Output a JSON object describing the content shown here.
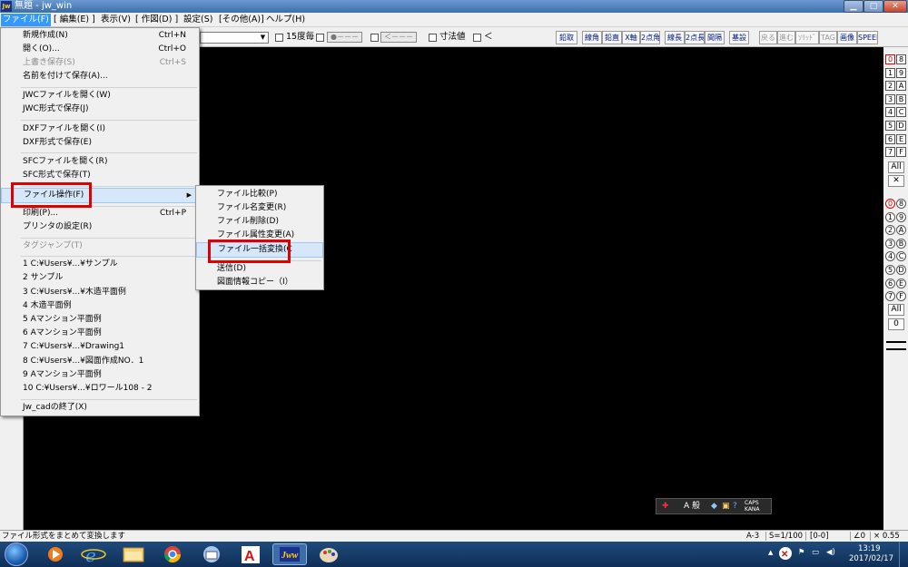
{
  "window": {
    "title": "無題 - jw_win",
    "app_icon": "Jw"
  },
  "menubar": [
    "ファイル(F)",
    "[ 編集(E) ]",
    "表示(V)",
    "[ 作図(D) ]",
    "設定(S)",
    "[その他(A)]",
    "ヘルプ(H)"
  ],
  "toolbar": {
    "check_15": "15度毎",
    "dash_box": "●－－－",
    "arrow_box": "＜－－－",
    "check_dim": "寸法値",
    "check_lt": "＜",
    "buttons": [
      "鉛取",
      "線角",
      "鉛直",
      "X軸",
      "2点角",
      "線長",
      "2点長",
      "間隔",
      "基設"
    ],
    "buttons_right": [
      "戻る",
      "進む",
      "ｿﾘｯﾄﾞ",
      "TAG",
      "画像",
      "SPEED"
    ],
    "disabled_right": [
      "戻る",
      "進む",
      "ｿﾘｯﾄﾞ",
      "TAG"
    ]
  },
  "file_menu": {
    "items": [
      {
        "label": "新規作成(N)",
        "shortcut": "Ctrl+N"
      },
      {
        "label": "開く(O)...",
        "shortcut": "Ctrl+O"
      },
      {
        "label": "上書き保存(S)",
        "shortcut": "Ctrl+S",
        "disabled": true
      },
      {
        "label": "名前を付けて保存(A)...",
        "shortcut": ""
      },
      {
        "label": "JWCファイルを開く(W)",
        "shortcut": ""
      },
      {
        "label": "JWC形式で保存(J)",
        "shortcut": ""
      },
      {
        "label": "DXFファイルを開く(I)",
        "shortcut": ""
      },
      {
        "label": "DXF形式で保存(E)",
        "shortcut": ""
      },
      {
        "label": "SFCファイルを開く(R)",
        "shortcut": ""
      },
      {
        "label": "SFC形式で保存(T)",
        "shortcut": ""
      },
      {
        "label": "ファイル操作(F)",
        "shortcut": "",
        "submenu": true
      },
      {
        "label": "印刷(P)...",
        "shortcut": "Ctrl+P"
      },
      {
        "label": "プリンタの設定(R)",
        "shortcut": ""
      },
      {
        "label": "タグジャンプ(T)",
        "shortcut": "",
        "disabled": true
      },
      {
        "label": "1 C:¥Users¥...¥サンプル",
        "shortcut": ""
      },
      {
        "label": "2 サンプル",
        "shortcut": ""
      },
      {
        "label": "3 C:¥Users¥...¥木造平面例",
        "shortcut": ""
      },
      {
        "label": "4 木造平面例",
        "shortcut": ""
      },
      {
        "label": "5 Aマンション平面例",
        "shortcut": ""
      },
      {
        "label": "6 Aマンション平面例",
        "shortcut": ""
      },
      {
        "label": "7 C:¥Users¥...¥Drawing1",
        "shortcut": ""
      },
      {
        "label": "8 C:¥Users¥...¥図面作成NO．1",
        "shortcut": ""
      },
      {
        "label": "9 Aマンション平面例",
        "shortcut": ""
      },
      {
        "label": "10 C:¥Users¥...¥ロワール108 - 2",
        "shortcut": ""
      },
      {
        "label": "Jw_cadの終了(X)",
        "shortcut": ""
      }
    ]
  },
  "file_ops_submenu": {
    "items": [
      "ファイル比較(P)",
      "ファイル名変更(R)",
      "ファイル削除(D)",
      "ファイル属性変更(A)",
      "ファイル一括変換(C",
      "送信(D)",
      "図面情報コピー（I）"
    ]
  },
  "layers": {
    "group_labels": [
      "0",
      "1",
      "2",
      "3",
      "4",
      "5",
      "6",
      "7"
    ],
    "group_hex": [
      "8",
      "9",
      "A",
      "B",
      "C",
      "D",
      "E",
      "F"
    ],
    "layer_labels": [
      "0",
      "1",
      "2",
      "3",
      "4",
      "5",
      "6",
      "7"
    ],
    "layer_hex": [
      "8",
      "9",
      "A",
      "B",
      "C",
      "D",
      "E",
      "F"
    ],
    "all": "All",
    "x": "✕",
    "zero": "0"
  },
  "ime": {
    "mode": "A 般",
    "caps": "CAPS",
    "kana": "KANA"
  },
  "statusbar": {
    "message": "ファイル形式をまとめて変換します",
    "paper": "A-3",
    "scale": "S=1/100",
    "layer": "[0-0]",
    "angle": "∠0",
    "zoom": "× 0.55"
  },
  "taskbar": {
    "time": "13:19",
    "date": "2017/02/17",
    "apps": [
      "ie-icon",
      "media-player-icon",
      "explorer-icon",
      "chrome-icon",
      "thunderbird-icon",
      "autocad-icon",
      "jwcad-icon",
      "paint-icon"
    ]
  },
  "colors": {
    "highlight": "#e00000",
    "canvas": "#000000",
    "menu_hover": "#d7e7fa"
  }
}
